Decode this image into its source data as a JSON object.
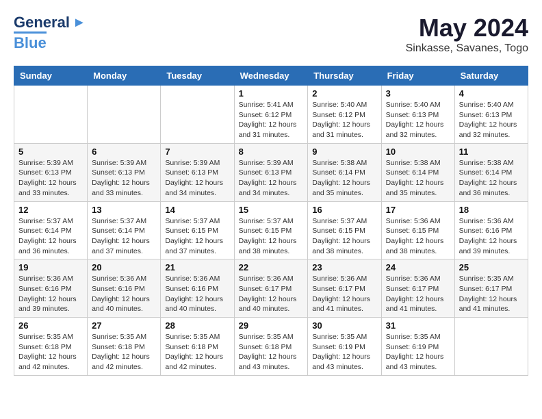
{
  "logo": {
    "line1": "General",
    "line2": "Blue"
  },
  "header": {
    "title": "May 2024",
    "subtitle": "Sinkasse, Savanes, Togo"
  },
  "weekdays": [
    "Sunday",
    "Monday",
    "Tuesday",
    "Wednesday",
    "Thursday",
    "Friday",
    "Saturday"
  ],
  "weeks": [
    [
      {
        "day": "",
        "detail": ""
      },
      {
        "day": "",
        "detail": ""
      },
      {
        "day": "",
        "detail": ""
      },
      {
        "day": "1",
        "detail": "Sunrise: 5:41 AM\nSunset: 6:12 PM\nDaylight: 12 hours\nand 31 minutes."
      },
      {
        "day": "2",
        "detail": "Sunrise: 5:40 AM\nSunset: 6:12 PM\nDaylight: 12 hours\nand 31 minutes."
      },
      {
        "day": "3",
        "detail": "Sunrise: 5:40 AM\nSunset: 6:13 PM\nDaylight: 12 hours\nand 32 minutes."
      },
      {
        "day": "4",
        "detail": "Sunrise: 5:40 AM\nSunset: 6:13 PM\nDaylight: 12 hours\nand 32 minutes."
      }
    ],
    [
      {
        "day": "5",
        "detail": "Sunrise: 5:39 AM\nSunset: 6:13 PM\nDaylight: 12 hours\nand 33 minutes."
      },
      {
        "day": "6",
        "detail": "Sunrise: 5:39 AM\nSunset: 6:13 PM\nDaylight: 12 hours\nand 33 minutes."
      },
      {
        "day": "7",
        "detail": "Sunrise: 5:39 AM\nSunset: 6:13 PM\nDaylight: 12 hours\nand 34 minutes."
      },
      {
        "day": "8",
        "detail": "Sunrise: 5:39 AM\nSunset: 6:13 PM\nDaylight: 12 hours\nand 34 minutes."
      },
      {
        "day": "9",
        "detail": "Sunrise: 5:38 AM\nSunset: 6:14 PM\nDaylight: 12 hours\nand 35 minutes."
      },
      {
        "day": "10",
        "detail": "Sunrise: 5:38 AM\nSunset: 6:14 PM\nDaylight: 12 hours\nand 35 minutes."
      },
      {
        "day": "11",
        "detail": "Sunrise: 5:38 AM\nSunset: 6:14 PM\nDaylight: 12 hours\nand 36 minutes."
      }
    ],
    [
      {
        "day": "12",
        "detail": "Sunrise: 5:37 AM\nSunset: 6:14 PM\nDaylight: 12 hours\nand 36 minutes."
      },
      {
        "day": "13",
        "detail": "Sunrise: 5:37 AM\nSunset: 6:14 PM\nDaylight: 12 hours\nand 37 minutes."
      },
      {
        "day": "14",
        "detail": "Sunrise: 5:37 AM\nSunset: 6:15 PM\nDaylight: 12 hours\nand 37 minutes."
      },
      {
        "day": "15",
        "detail": "Sunrise: 5:37 AM\nSunset: 6:15 PM\nDaylight: 12 hours\nand 38 minutes."
      },
      {
        "day": "16",
        "detail": "Sunrise: 5:37 AM\nSunset: 6:15 PM\nDaylight: 12 hours\nand 38 minutes."
      },
      {
        "day": "17",
        "detail": "Sunrise: 5:36 AM\nSunset: 6:15 PM\nDaylight: 12 hours\nand 38 minutes."
      },
      {
        "day": "18",
        "detail": "Sunrise: 5:36 AM\nSunset: 6:16 PM\nDaylight: 12 hours\nand 39 minutes."
      }
    ],
    [
      {
        "day": "19",
        "detail": "Sunrise: 5:36 AM\nSunset: 6:16 PM\nDaylight: 12 hours\nand 39 minutes."
      },
      {
        "day": "20",
        "detail": "Sunrise: 5:36 AM\nSunset: 6:16 PM\nDaylight: 12 hours\nand 40 minutes."
      },
      {
        "day": "21",
        "detail": "Sunrise: 5:36 AM\nSunset: 6:16 PM\nDaylight: 12 hours\nand 40 minutes."
      },
      {
        "day": "22",
        "detail": "Sunrise: 5:36 AM\nSunset: 6:17 PM\nDaylight: 12 hours\nand 40 minutes."
      },
      {
        "day": "23",
        "detail": "Sunrise: 5:36 AM\nSunset: 6:17 PM\nDaylight: 12 hours\nand 41 minutes."
      },
      {
        "day": "24",
        "detail": "Sunrise: 5:36 AM\nSunset: 6:17 PM\nDaylight: 12 hours\nand 41 minutes."
      },
      {
        "day": "25",
        "detail": "Sunrise: 5:35 AM\nSunset: 6:17 PM\nDaylight: 12 hours\nand 41 minutes."
      }
    ],
    [
      {
        "day": "26",
        "detail": "Sunrise: 5:35 AM\nSunset: 6:18 PM\nDaylight: 12 hours\nand 42 minutes."
      },
      {
        "day": "27",
        "detail": "Sunrise: 5:35 AM\nSunset: 6:18 PM\nDaylight: 12 hours\nand 42 minutes."
      },
      {
        "day": "28",
        "detail": "Sunrise: 5:35 AM\nSunset: 6:18 PM\nDaylight: 12 hours\nand 42 minutes."
      },
      {
        "day": "29",
        "detail": "Sunrise: 5:35 AM\nSunset: 6:18 PM\nDaylight: 12 hours\nand 43 minutes."
      },
      {
        "day": "30",
        "detail": "Sunrise: 5:35 AM\nSunset: 6:19 PM\nDaylight: 12 hours\nand 43 minutes."
      },
      {
        "day": "31",
        "detail": "Sunrise: 5:35 AM\nSunset: 6:19 PM\nDaylight: 12 hours\nand 43 minutes."
      },
      {
        "day": "",
        "detail": ""
      }
    ]
  ]
}
